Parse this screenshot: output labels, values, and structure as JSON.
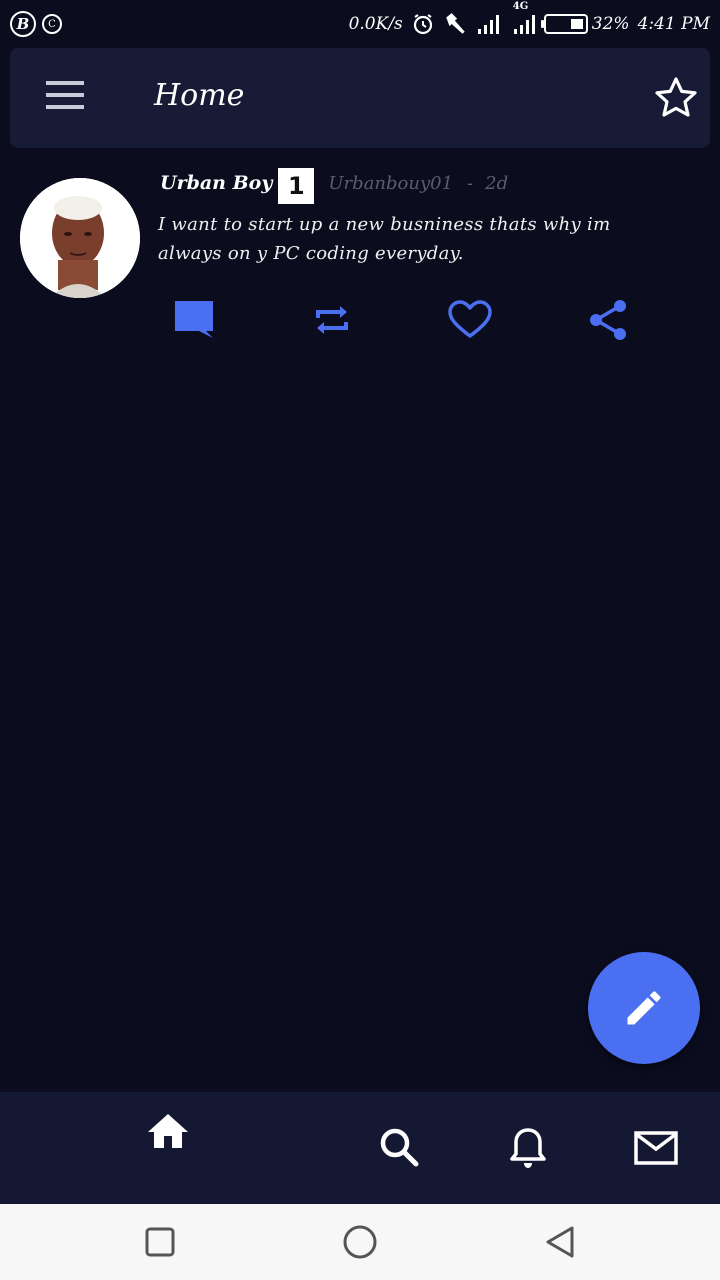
{
  "status_bar": {
    "left_icon_b": "B",
    "left_icon_c": "C",
    "net_speed": "0.0K/s",
    "network_type": "4G",
    "battery_pct": "32%",
    "time": "4:41 PM",
    "icons": [
      "alarm-icon",
      "hammer-icon",
      "signal-icon",
      "signal-icon",
      "battery-icon"
    ]
  },
  "app_bar": {
    "title": "Home",
    "menu_icon": "hamburger-menu-icon",
    "star_icon": "star-outline-icon"
  },
  "post": {
    "author_name": "Urban Boy",
    "badge": "1",
    "handle": "Urbanbouy01",
    "separator": "-",
    "age": "2d",
    "body": "I want to start up a new busniness thats why im always on y PC coding everyday.",
    "actions": [
      {
        "name": "comment",
        "icon": "comment-icon"
      },
      {
        "name": "retweet",
        "icon": "repeat-icon"
      },
      {
        "name": "like",
        "icon": "heart-outline-icon"
      },
      {
        "name": "share",
        "icon": "share-icon"
      }
    ]
  },
  "fab": {
    "icon": "pencil-icon"
  },
  "bottom_nav": {
    "items": [
      {
        "name": "home",
        "icon": "home-icon"
      },
      {
        "name": "search",
        "icon": "search-icon"
      },
      {
        "name": "notifications",
        "icon": "bell-icon"
      },
      {
        "name": "messages",
        "icon": "mail-icon"
      }
    ]
  },
  "system_nav": {
    "items": [
      "recents-button",
      "home-button",
      "back-button"
    ]
  },
  "colors": {
    "background": "#0b0c1e",
    "app_bar": "#181b35",
    "accent": "#4a6ff0",
    "bottom_nav": "#151832",
    "muted_text": "#5a5d70"
  }
}
